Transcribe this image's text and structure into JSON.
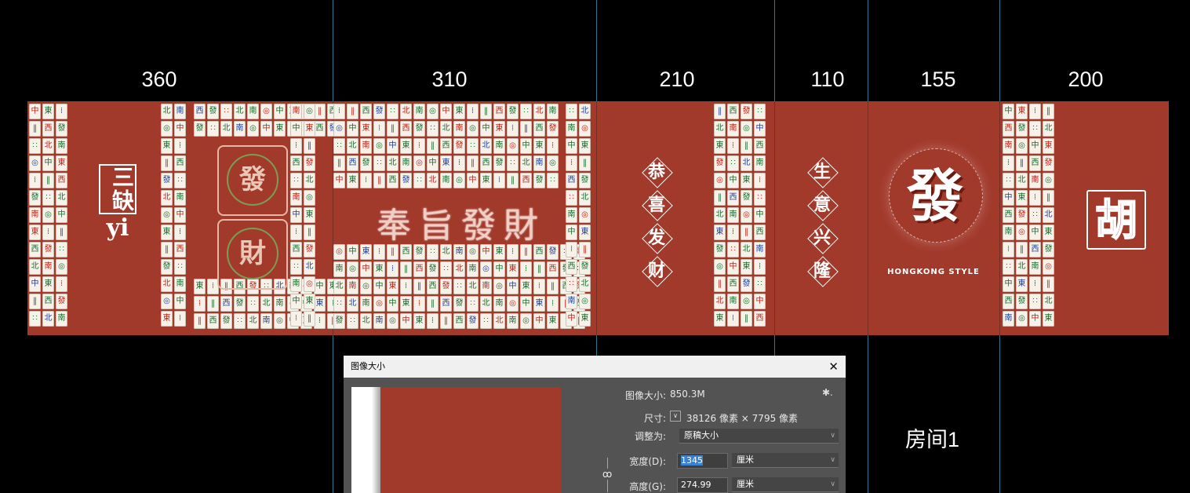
{
  "dimension_labels": [
    "360",
    "310",
    "210",
    "110",
    "155",
    "200"
  ],
  "panel1": {
    "box_text": "三缺",
    "sub_text": "yi"
  },
  "panel2": {
    "badges": [
      "發",
      "財"
    ],
    "banner": "奉旨發財"
  },
  "panel3": {
    "chars": [
      "恭",
      "喜",
      "发",
      "财"
    ]
  },
  "panel4": {
    "chars": [
      "生",
      "意",
      "兴",
      "隆"
    ]
  },
  "panel5": {
    "main_char": "發",
    "caption": "HONGKONG STYLE"
  },
  "panel6": {
    "char": "胡"
  },
  "room_label": "房间1",
  "colors": {
    "background": "#a23a2c",
    "guide": "#2b8fa6"
  },
  "dialog": {
    "title": "图像大小",
    "close_icon": "close-icon",
    "image_size_label": "图像大小:",
    "image_size_value": "850.3M",
    "dimensions_label": "尺寸:",
    "dimensions_value": "38126 像素 × 7795 像素",
    "fit_label": "调整为:",
    "fit_value": "原稿大小",
    "width_label": "宽度(D):",
    "width_value": "1345",
    "width_unit": "厘米",
    "height_label": "高度(G):",
    "height_value": "274.99",
    "height_unit": "厘米"
  }
}
